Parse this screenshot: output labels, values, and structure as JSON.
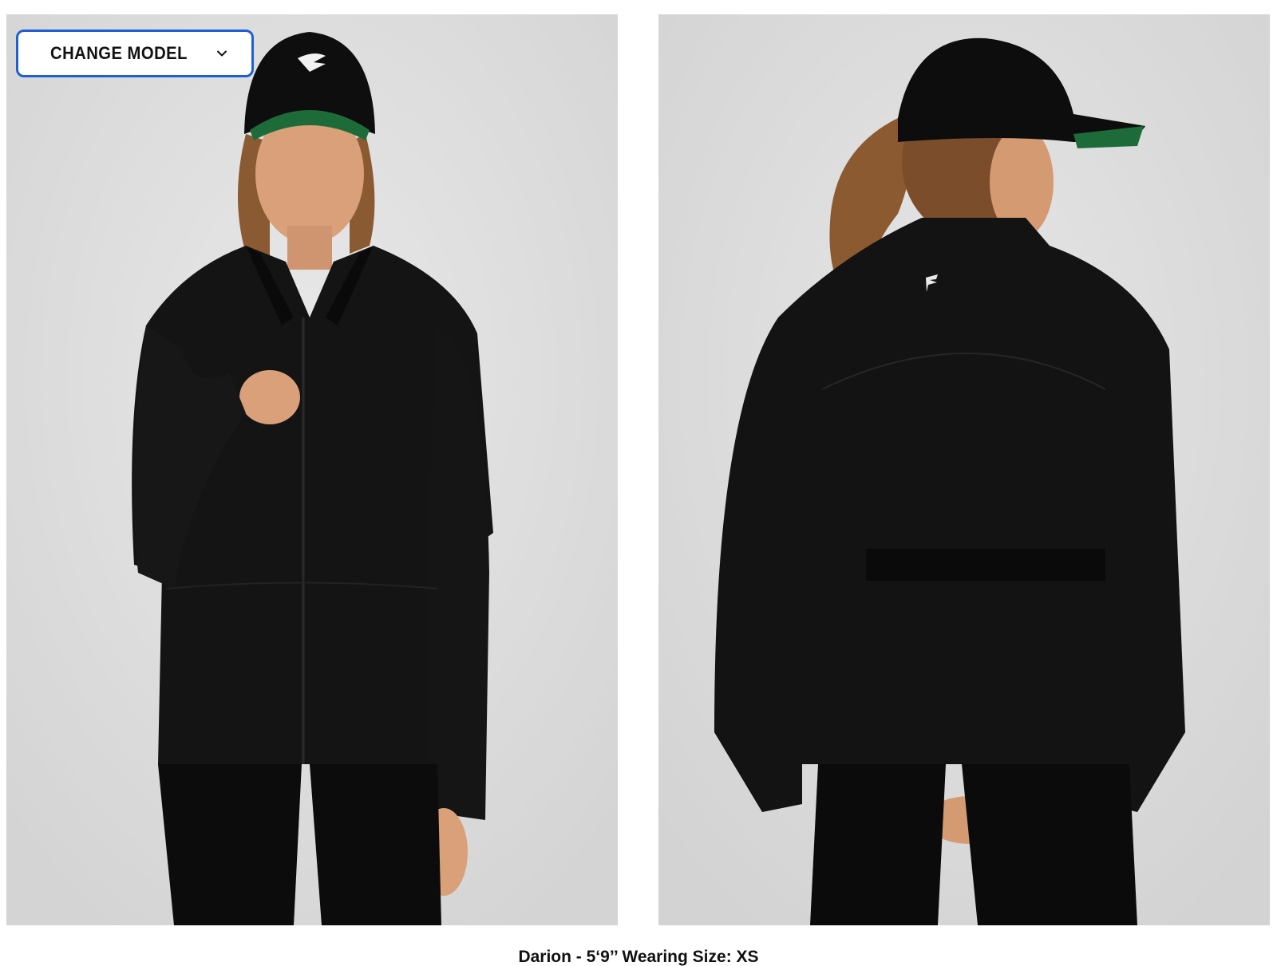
{
  "change_model": {
    "label": "CHANGE MODEL",
    "chevron_icon": "chevron-down-icon",
    "accent_color": "#1f5fd6"
  },
  "images": [
    {
      "view": "front"
    },
    {
      "view": "back"
    }
  ],
  "caption": "Darion - 5‘9’’ Wearing Size: XS"
}
